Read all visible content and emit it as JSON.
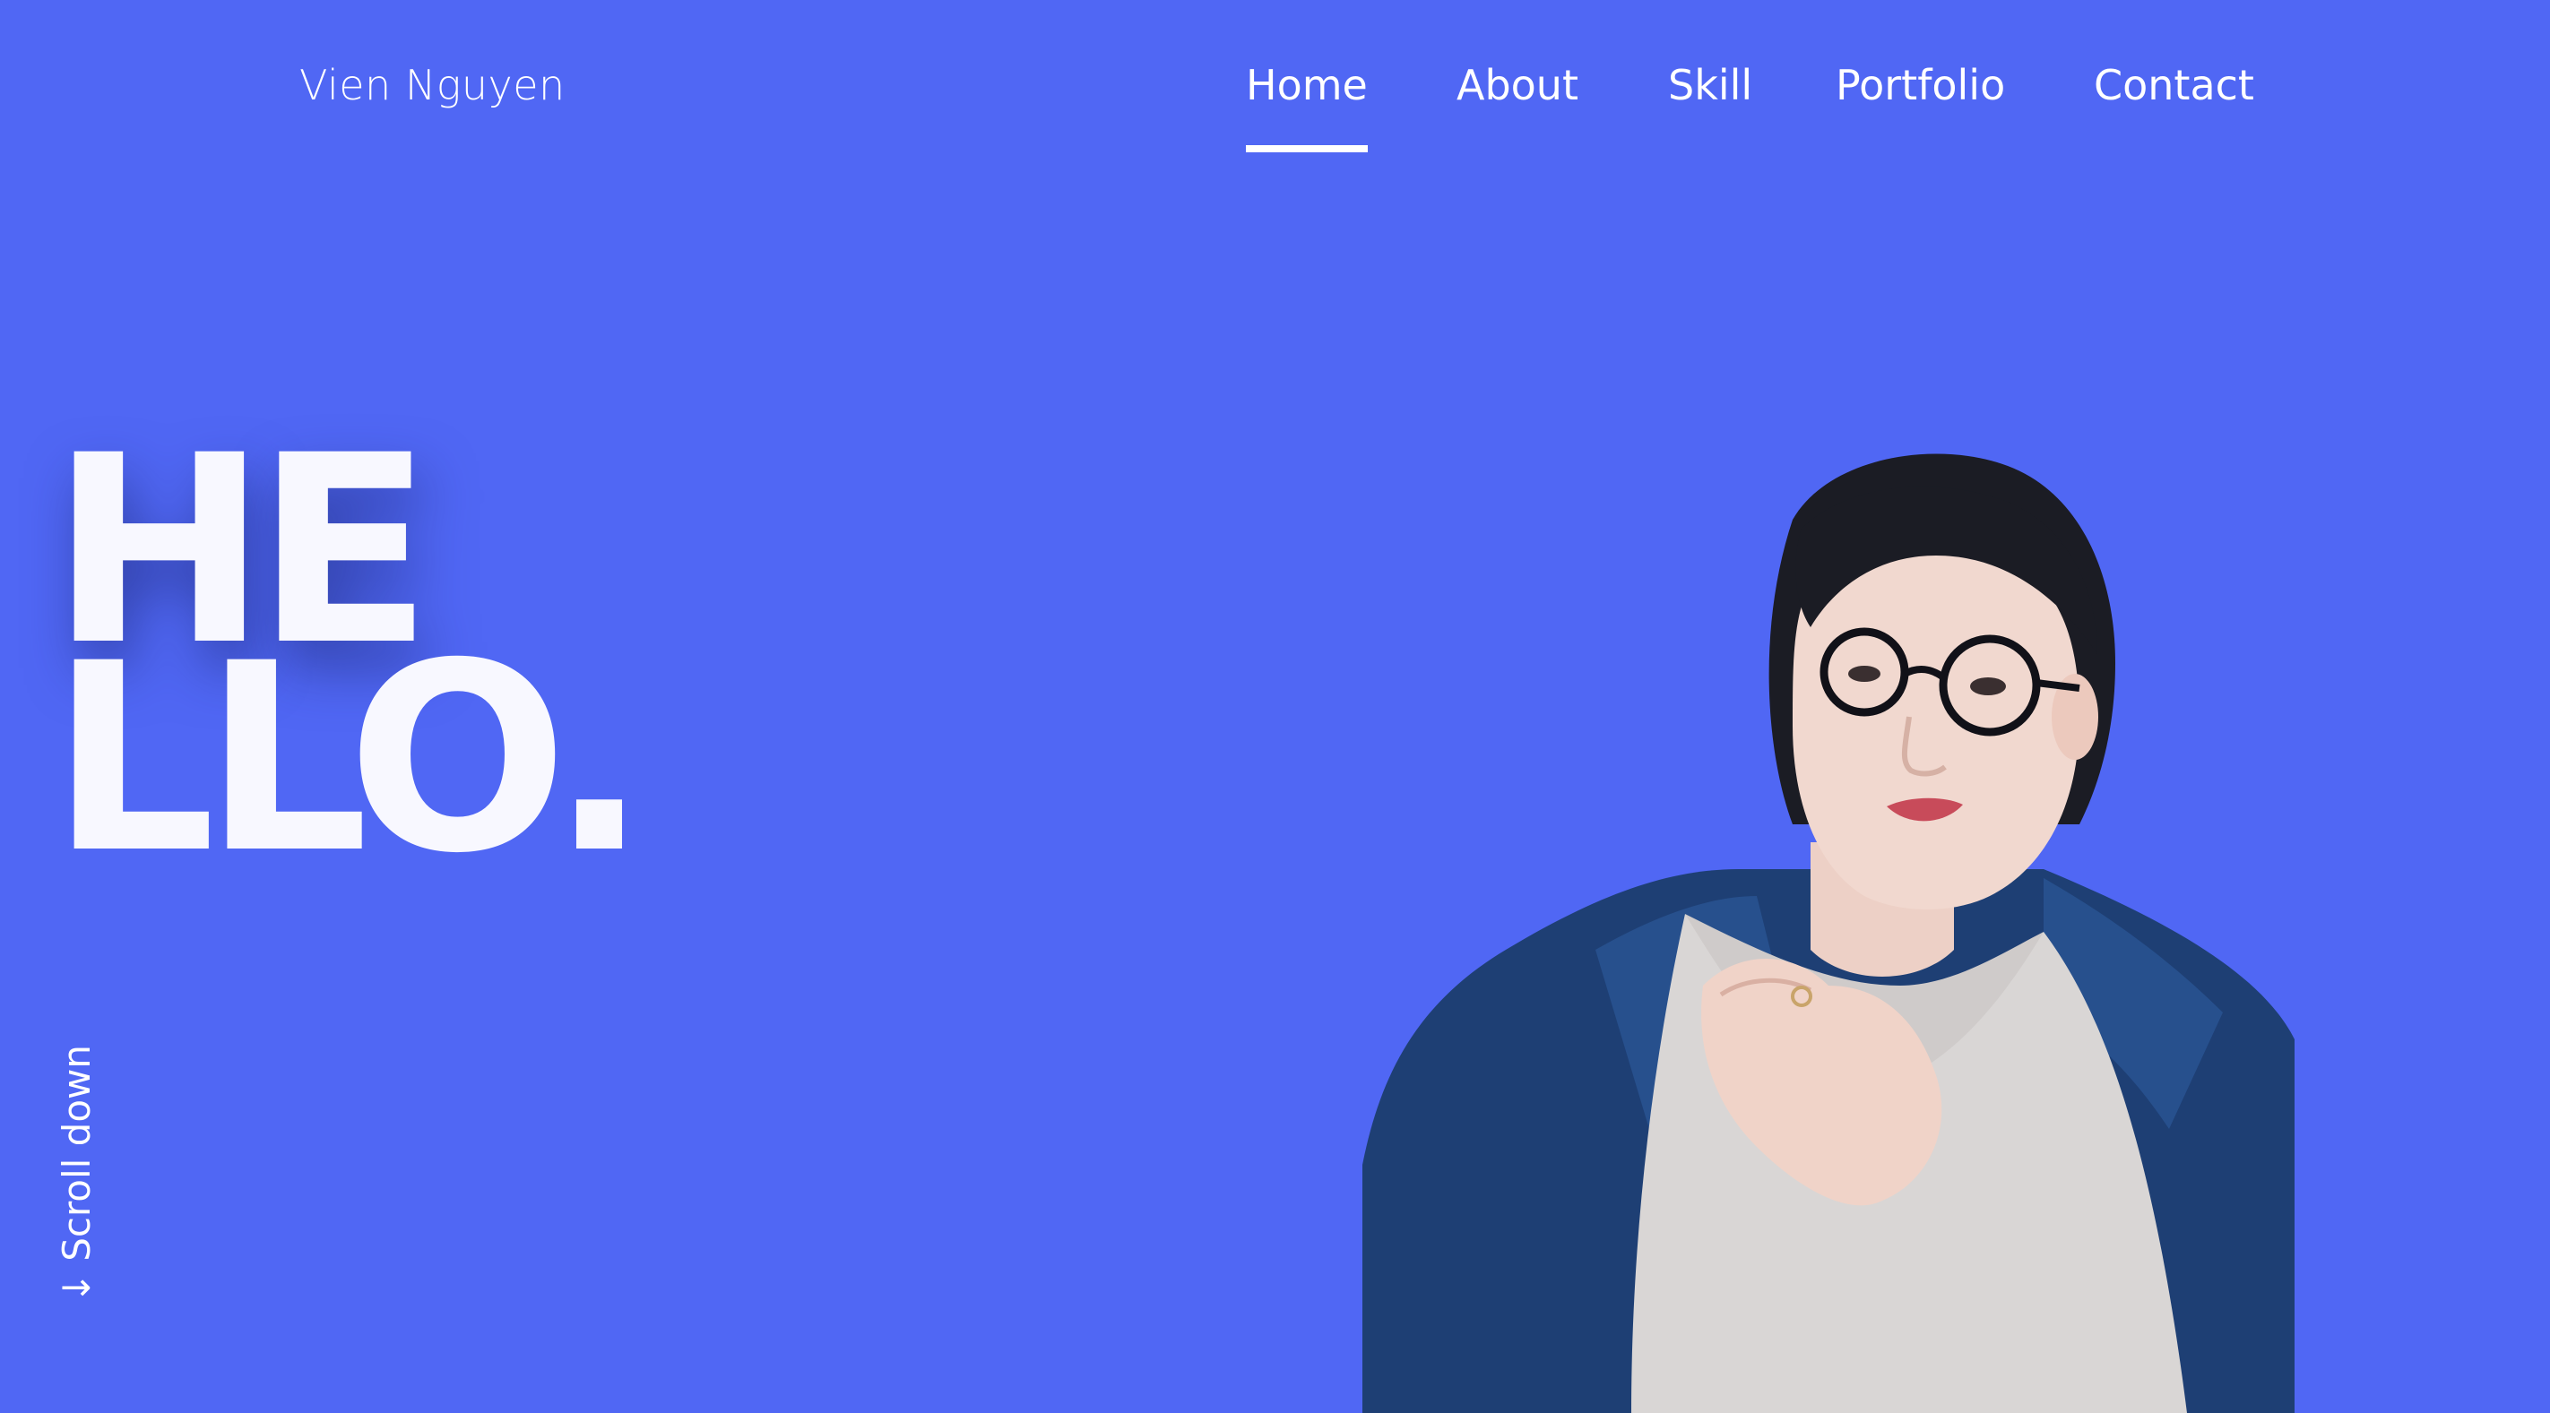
{
  "header": {
    "brand": "Vien Nguyen",
    "nav": [
      {
        "label": "Home",
        "active": true
      },
      {
        "label": "About",
        "active": false
      },
      {
        "label": "Skill",
        "active": false
      },
      {
        "label": "Portfolio",
        "active": false
      },
      {
        "label": "Contact",
        "active": false
      }
    ]
  },
  "hero": {
    "line1": "HE",
    "line2": "LLO."
  },
  "scroll": {
    "arrow": "↓",
    "label": "Scroll down"
  },
  "colors": {
    "background": "#5067f4",
    "text": "#ffffff",
    "jacket": "#1e3f74",
    "sweater": "#d9d6d5",
    "hair": "#1b1c24",
    "skin": "#f1d8cf"
  },
  "icons": {
    "scroll_arrow": "arrow-down-icon"
  }
}
